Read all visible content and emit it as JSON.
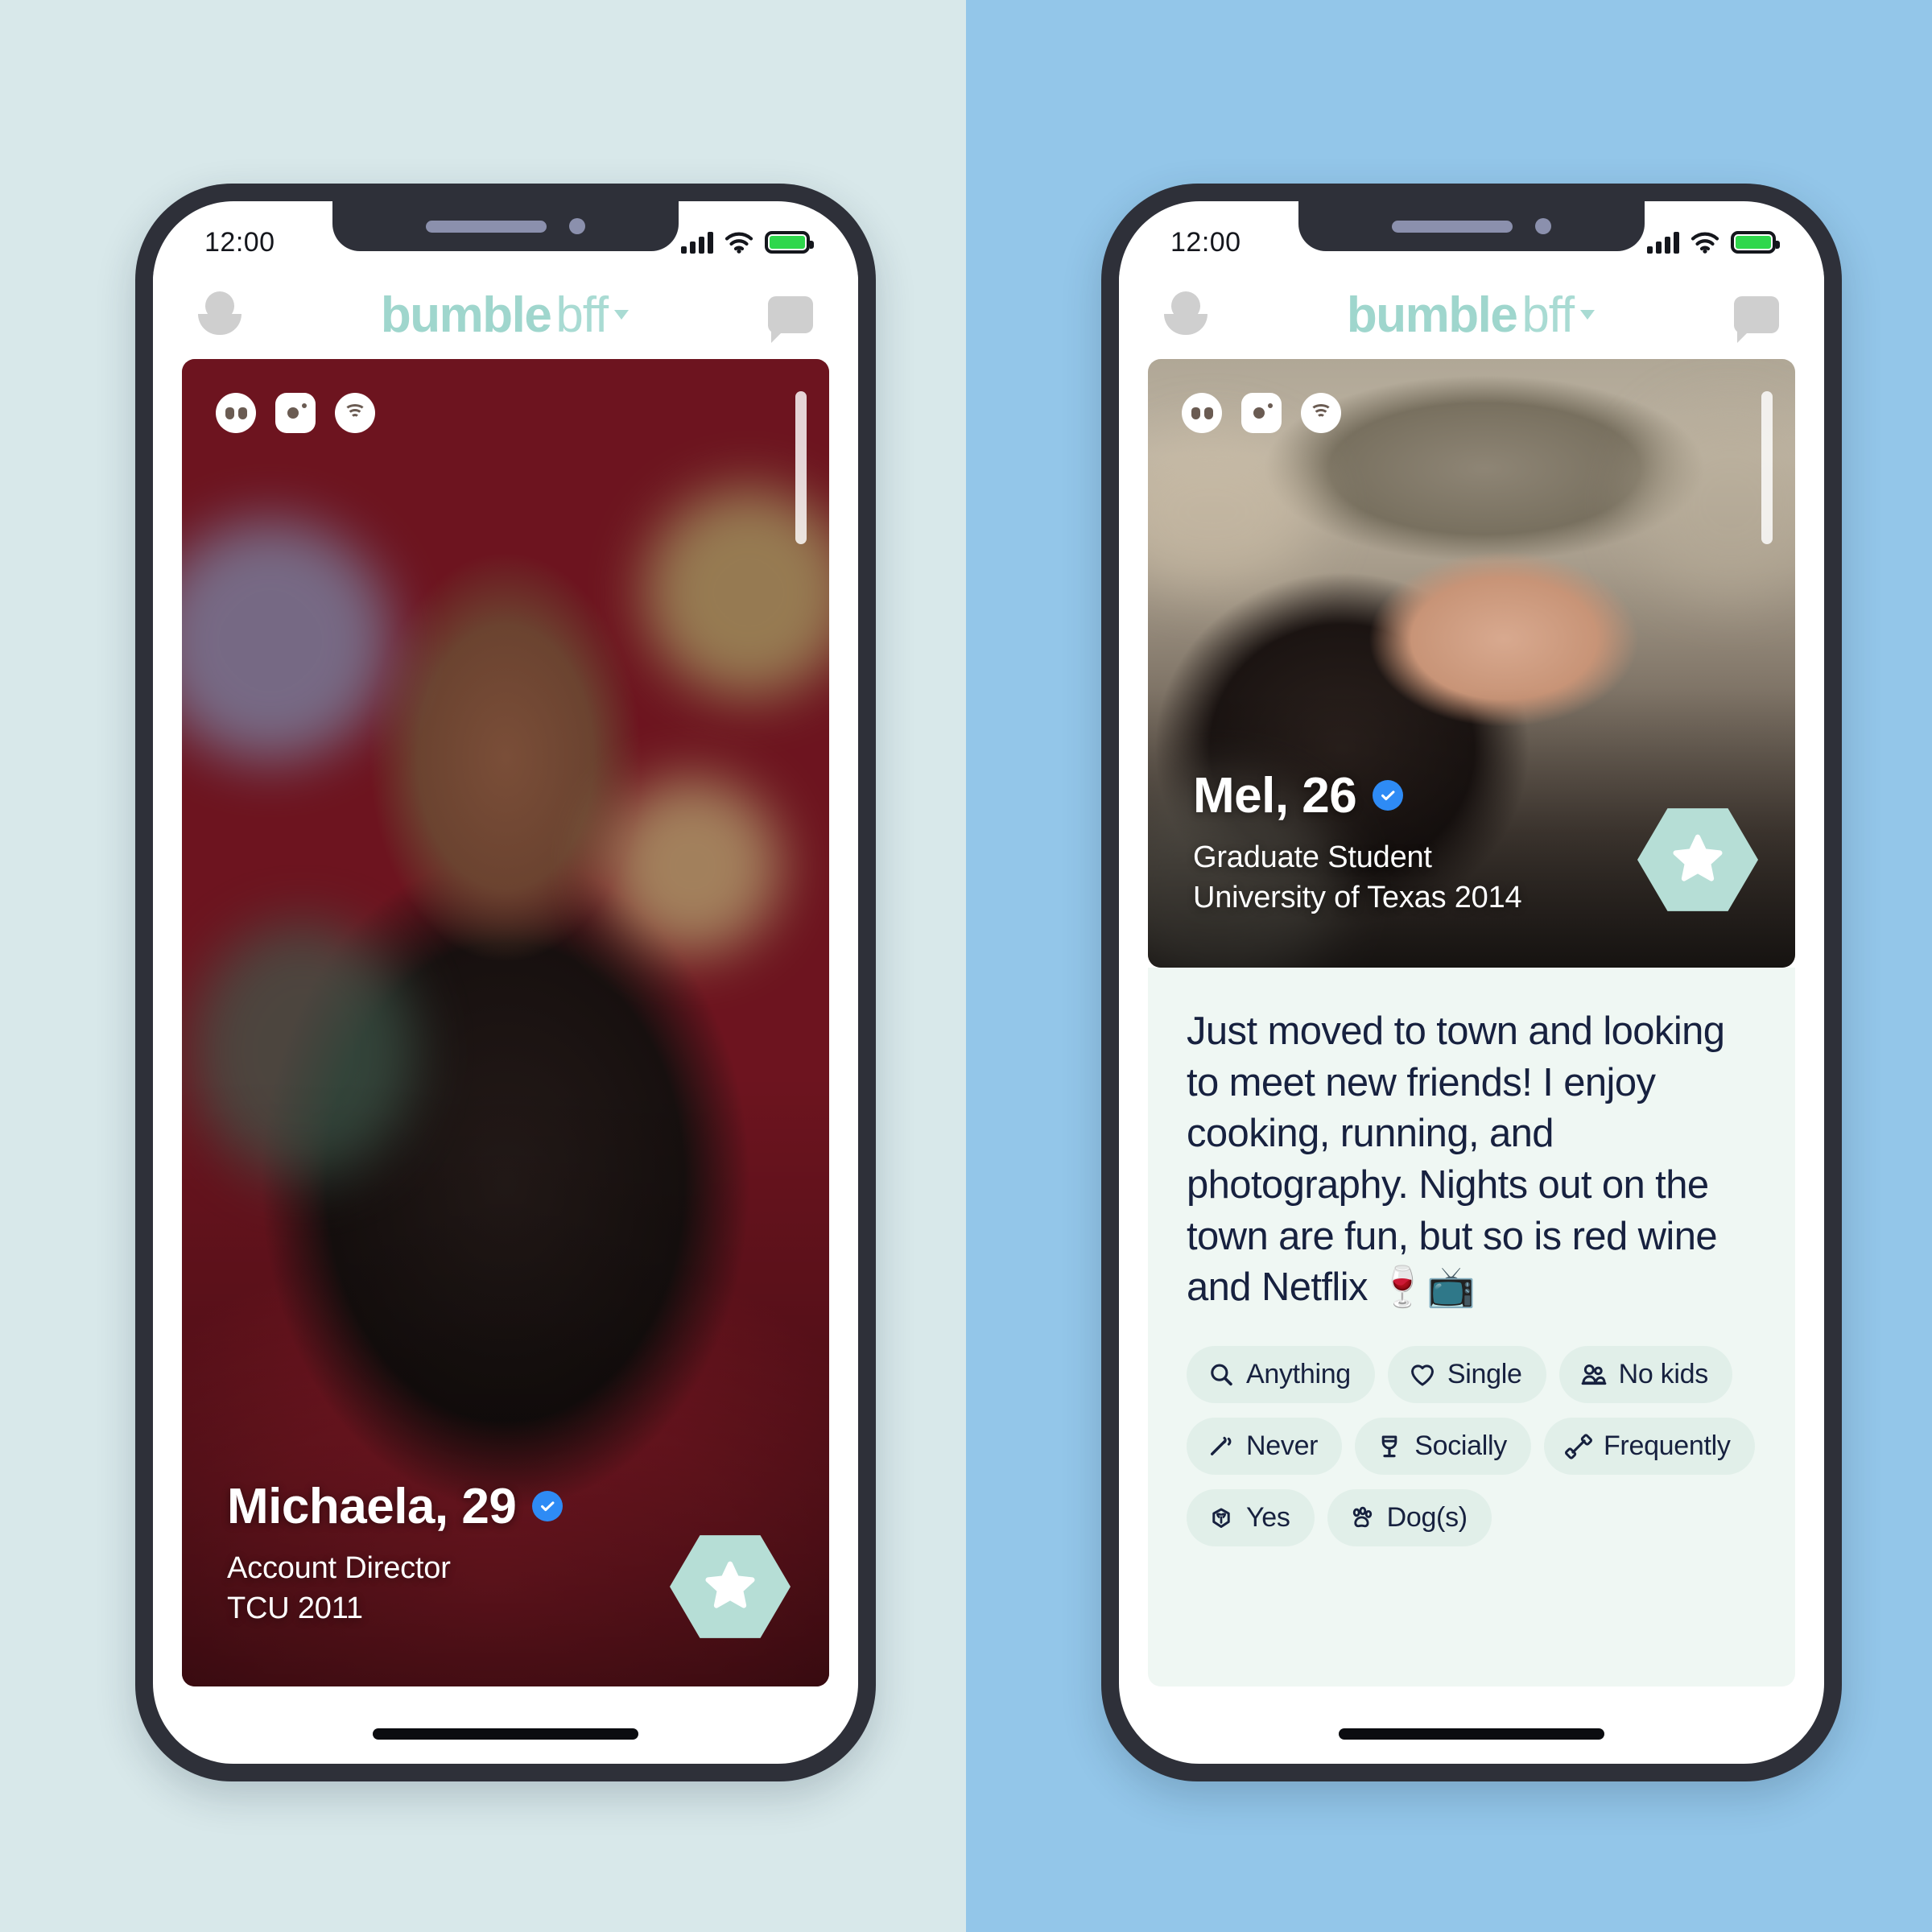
{
  "background": {
    "left_color": "#d8e8ea",
    "right_color": "#93c6e9"
  },
  "brand": {
    "primary": "bumble",
    "secondary": "bff",
    "color": "#9fd6cd",
    "caret_icon": "triangle-down-icon"
  },
  "header": {
    "avatar_icon": "person-avatar-icon",
    "chat_icon": "chat-bubble-icon"
  },
  "status_bar": {
    "time": "12:00",
    "signal_icon": "cellular-signal-icon",
    "wifi_icon": "wifi-icon",
    "battery_icon": "battery-full-icon",
    "battery_color": "#2fd74c"
  },
  "photo_badges": [
    {
      "name": "prompt-eyes-icon",
      "label": "Profile prompt"
    },
    {
      "name": "instagram-icon",
      "label": "Instagram connected"
    },
    {
      "name": "spotify-icon",
      "label": "Spotify connected"
    }
  ],
  "phones": [
    {
      "id": "phone-left",
      "profile": {
        "name": "Michaela, 29",
        "verified": true,
        "occupation": "Account Director",
        "education": "TCU 2011"
      },
      "action_button": {
        "name": "superswipe-star-button",
        "icon": "star-icon",
        "color": "#b6ded6"
      }
    },
    {
      "id": "phone-right",
      "profile": {
        "name": "Mel, 26",
        "verified": true,
        "occupation": "Graduate Student",
        "education": "University of Texas 2014"
      },
      "bio": "Just moved to town and looking to meet new friends! I enjoy cooking, running, and photography. Nights out on the town are fun, but so is red wine and Netflix 🍷📺",
      "action_button": {
        "name": "superswipe-star-button",
        "icon": "star-icon",
        "color": "#b6ded6"
      },
      "attributes": [
        {
          "label": "Anything",
          "icon": "magnifier-icon"
        },
        {
          "label": "Single",
          "icon": "heart-icon"
        },
        {
          "label": "No kids",
          "icon": "family-icon"
        },
        {
          "label": "Never",
          "icon": "cigarette-icon"
        },
        {
          "label": "Socially",
          "icon": "wine-glass-icon"
        },
        {
          "label": "Frequently",
          "icon": "dumbbell-icon"
        },
        {
          "label": "Yes",
          "icon": "plant-icon"
        },
        {
          "label": "Dog(s)",
          "icon": "paw-print-icon"
        }
      ]
    }
  ],
  "colors": {
    "bezel": "#2e3039",
    "bio_panel": "#eff7f3",
    "chip_bg": "#e1efe9",
    "text_dark": "#17213f",
    "verified_blue": "#2e8bf5"
  }
}
